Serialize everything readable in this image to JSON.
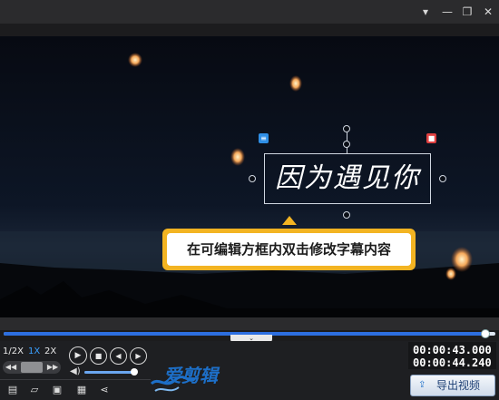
{
  "window": {
    "menu_icon": "caret-down-icon",
    "minimize_icon": "minimize-icon",
    "restore_icon": "restore-icon",
    "close_icon": "close-icon"
  },
  "editor": {
    "subtitle_text": "因为遇见你",
    "tooltip_text": "在可编辑方框内双击修改字幕内容"
  },
  "playback": {
    "progress_fraction": 0.98,
    "speed_options": [
      "1/2X",
      "1X",
      "2X"
    ],
    "active_speed": "1X",
    "volume_fraction": 0.95
  },
  "time": {
    "current": "00:00:43.000",
    "total": "00:00:44.240"
  },
  "export": {
    "label": "导出视频"
  },
  "brand": {
    "logo_text": "爱剪辑"
  },
  "colors": {
    "accent": "#2d6fe0",
    "tooltip_border": "#f3b422",
    "delete": "#e04040"
  }
}
